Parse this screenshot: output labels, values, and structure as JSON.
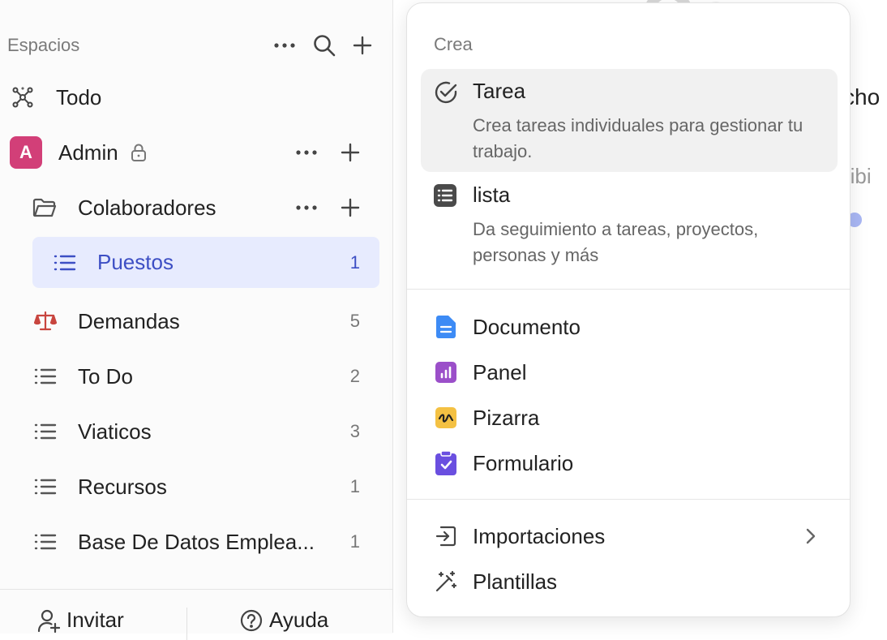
{
  "sidebar": {
    "header_title": "Espacios",
    "header_icons": [
      "more-horizontal-icon",
      "search-icon",
      "plus-icon"
    ],
    "all_label": "Todo",
    "space": {
      "avatar_letter": "A",
      "name": "Admin",
      "avatar_color": "#d23f78",
      "locked": true
    },
    "folder": {
      "name": "Colaboradores"
    },
    "lists": [
      {
        "label": "Puestos",
        "count": "1",
        "icon": "list-icon",
        "active": true
      },
      {
        "label": "Demandas",
        "count": "5",
        "icon": "scales-icon"
      },
      {
        "label": "To Do",
        "count": "2",
        "icon": "list-icon"
      },
      {
        "label": "Viaticos",
        "count": "3",
        "icon": "list-icon"
      },
      {
        "label": "Recursos",
        "count": "1",
        "icon": "list-icon"
      },
      {
        "label": "Base De Datos Emplea...",
        "count": "1",
        "icon": "list-icon"
      }
    ],
    "footer": {
      "invite_label": "Invitar",
      "help_label": "Ayuda"
    }
  },
  "background": {
    "fragment_1": "cho",
    "fragment_2": "ribi"
  },
  "menu": {
    "section_title": "Crea",
    "create_items": [
      {
        "name": "Tarea",
        "description": "Crea tareas individuales para gestionar tu trabajo.",
        "icon": "check-circle-icon"
      },
      {
        "name": "lista",
        "description": "Da seguimiento a tareas, proyectos, personas y más",
        "icon": "list-box-icon"
      }
    ],
    "items": [
      {
        "name": "Documento",
        "icon": "document-icon",
        "color": "#3d8bf5"
      },
      {
        "name": "Panel",
        "icon": "dashboard-icon",
        "color": "#9b4fc9"
      },
      {
        "name": "Pizarra",
        "icon": "whiteboard-icon",
        "color": "#f4c143"
      },
      {
        "name": "Formulario",
        "icon": "form-icon",
        "color": "#6a4fe0"
      }
    ],
    "extra_items": [
      {
        "name": "Importaciones",
        "icon": "import-icon",
        "has_submenu": true
      },
      {
        "name": "Plantillas",
        "icon": "magic-wand-icon"
      }
    ]
  },
  "colors": {
    "accent": "#3d4fc4",
    "active_bg": "#e7ebfe",
    "scales": "#c8453f"
  }
}
